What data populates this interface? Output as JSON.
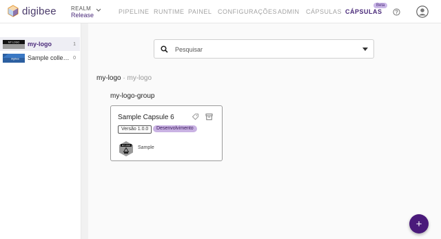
{
  "app": {
    "name": "digibee"
  },
  "realm": {
    "label": "REALM",
    "value": "Release"
  },
  "nav": [
    {
      "label": "PIPELINE"
    },
    {
      "label": "RUNTIME"
    },
    {
      "label": "PAINEL"
    },
    {
      "label": "CONFIGURAÇÕES"
    },
    {
      "label": "ADMIN"
    },
    {
      "label": "CÁPSULAS"
    },
    {
      "label": "CÁPSULAS",
      "active": true,
      "badge": "Beta"
    }
  ],
  "sidebar": {
    "items": [
      {
        "label": "my-logo",
        "count": "1",
        "selected": true,
        "thumb_text": "MY LOGO"
      },
      {
        "label": "Sample collection",
        "count": "0",
        "selected": false,
        "thumb_text": "digibee"
      }
    ]
  },
  "search": {
    "placeholder": "Pesquisar",
    "value": ""
  },
  "breadcrumb": {
    "main": "my-logo",
    "separator": "·",
    "sub": "my-logo"
  },
  "group": {
    "title": "my-logo-group"
  },
  "card": {
    "title": "Sample Capsule 6",
    "version": "Versão 1.0.0",
    "status": "Desenvolvimento",
    "collection_name": "Sample",
    "collection_thumb_text": "MY LOGO"
  },
  "fab": {
    "label": "+"
  },
  "colors": {
    "brand": "#4a2a7a",
    "fab": "#4a1a7a",
    "status_badge": "#c9b2e3",
    "beta_badge": "#cbb8e8"
  },
  "icons": [
    "digibee-logo-icon",
    "chevron-down-icon",
    "help-icon",
    "user-avatar-icon",
    "search-icon",
    "caret-down-icon",
    "tag-icon",
    "archive-icon",
    "plus-icon"
  ]
}
